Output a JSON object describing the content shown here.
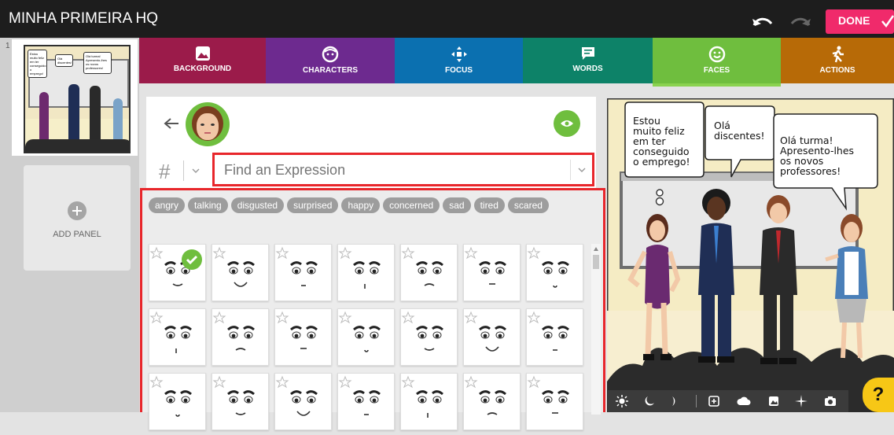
{
  "app": {
    "title": "MINHA PRIMEIRA HQ",
    "done_label": "DONE"
  },
  "sidebar": {
    "panel_number": "1",
    "add_panel_label": "ADD PANEL"
  },
  "tabs": [
    {
      "label": "BACKGROUND",
      "color": "#9b1b4a",
      "icon": "image-icon"
    },
    {
      "label": "CHARACTERS",
      "color": "#6d2a8f",
      "icon": "face-icon"
    },
    {
      "label": "FOCUS",
      "color": "#0b70b0",
      "icon": "move-arrows-icon"
    },
    {
      "label": "WORDS",
      "color": "#0d8268",
      "icon": "speech-icon"
    },
    {
      "label": "FACES",
      "color": "#6fbe3e",
      "icon": "smiley-icon"
    },
    {
      "label": "ACTIONS",
      "color": "#b76a07",
      "icon": "running-person-icon"
    }
  ],
  "editor": {
    "hash_symbol": "#",
    "search_placeholder": "Find an Expression",
    "chips": [
      "angry",
      "talking",
      "disgusted",
      "surprised",
      "happy",
      "concerned",
      "sad",
      "tired",
      "scared"
    ]
  },
  "scene": {
    "bubbles": [
      {
        "text": "Estou muito feliz em ter conseguido o emprego!",
        "lines": [
          "Estou",
          "muito feliz",
          "em ter",
          "conseguido",
          "o emprego!"
        ]
      },
      {
        "text": "Olá discentes!",
        "lines": [
          "Olá",
          "discentes!"
        ]
      },
      {
        "text": "Olá turma! Apresento-lhes os novos professores!",
        "lines": [
          "Olá turma!",
          "Apresento-lhes",
          "os novos",
          "professores!"
        ]
      }
    ]
  },
  "thumbnail": {
    "bubbles": [
      [
        "Estou",
        "muito feliz",
        "em ter",
        "conseguido",
        "o emprego!"
      ],
      [
        "Olá",
        "discentes!"
      ],
      [
        "Olá turma!",
        "Apresento-lhes",
        "os novos",
        "professores!"
      ]
    ]
  },
  "help": {
    "label": "?"
  },
  "colors": {
    "accent": "#f02a6b",
    "highlight": "#e8262b",
    "eye_button": "#6fbe3e"
  }
}
